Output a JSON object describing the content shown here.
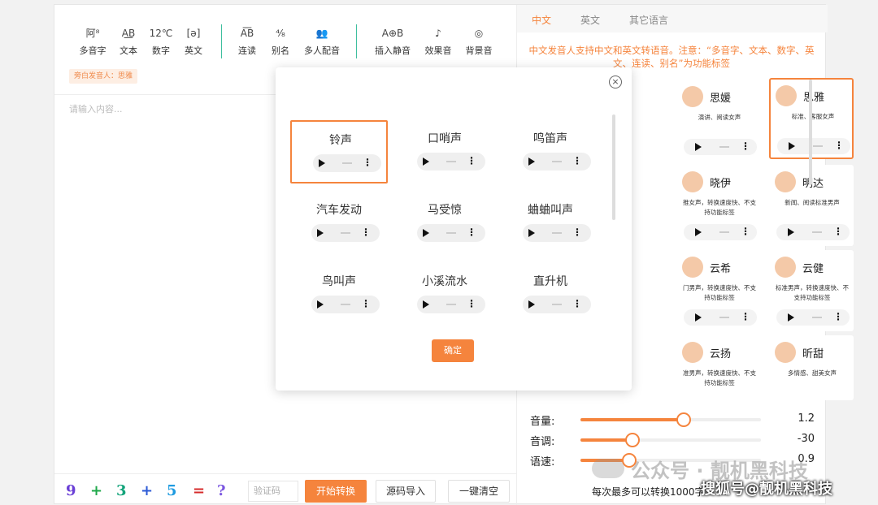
{
  "toolbar": {
    "items": [
      {
        "icon_text": "阿⁸",
        "label": "多音字"
      },
      {
        "icon_text": "A͟B",
        "label": "文本"
      },
      {
        "icon_text": "12℃",
        "label": "数字"
      },
      {
        "icon_text": "[ə]",
        "label": "英文"
      },
      {
        "icon_text": "A͞B",
        "label": "连读"
      },
      {
        "icon_text": "⁴⁄₈",
        "label": "别名"
      },
      {
        "icon_text": "👥",
        "label": "多人配音"
      },
      {
        "icon_text": "A⊕B",
        "label": "插入静音"
      },
      {
        "icon_text": "♪",
        "label": "效果音"
      },
      {
        "icon_text": "◎",
        "label": "背景音"
      }
    ]
  },
  "narrator_tag": "旁白发音人：思雅",
  "editor": {
    "placeholder": "请输入内容..."
  },
  "bottom": {
    "captcha_chars": [
      "9",
      "+",
      "3",
      "+",
      "5",
      "=",
      "?"
    ],
    "captcha_colors": [
      "#6a3fd6",
      "#1fa84a",
      "#12a37a",
      "#2d5bd6",
      "#1f9be0",
      "#d62b2b",
      "#7a55e0"
    ],
    "captcha_placeholder": "验证码",
    "start_label": "开始转换",
    "import_label": "源码导入",
    "clear_label": "一键清空"
  },
  "right": {
    "tabs": [
      "中文",
      "英文",
      "其它语言"
    ],
    "notice": "中文发音人支持中文和英文转语音。注意：“多音字、文本、数字、英文、连读、别名”为功能标签",
    "voices": [
      {
        "name": "思媛",
        "desc": "演讲、阅读女声"
      },
      {
        "name": "思雅",
        "desc": "标准、客服女声"
      },
      {
        "name": "晓伊",
        "desc": "推女声，转换速度快、不支持功能标签"
      },
      {
        "name": "明达",
        "desc": "新闻、阅读标准男声"
      },
      {
        "name": "云希",
        "desc": "门男声，转换速度快、不支持功能标签"
      },
      {
        "name": "云健",
        "desc": "标准男声，转换速度快、不支持功能标签"
      },
      {
        "name": "云扬",
        "desc": "准男声，转换速度快、不支持功能标签"
      },
      {
        "name": "昕甜",
        "desc": "多情感、甜美女声"
      }
    ],
    "sliders": [
      {
        "label": "音量:",
        "value": "1.2",
        "fraction": 0.57
      },
      {
        "label": "音调:",
        "value": "-30",
        "fraction": 0.29
      },
      {
        "label": "语速:",
        "value": "0.9",
        "fraction": 0.27
      }
    ],
    "limit_text": "每次最多可以转换1000字"
  },
  "modal": {
    "sounds": [
      "铃声",
      "口哨声",
      "鸣笛声",
      "汽车发动",
      "马受惊",
      "蛐蛐叫声",
      "鸟叫声",
      "小溪流水",
      "直升机"
    ],
    "confirm_label": "确定"
  },
  "watermark": {
    "text1": "公众号 · 靓机黑科技",
    "text2": "搜狐号@靓机黑科技"
  },
  "colors": {
    "accent": "#f5843d",
    "teal_separator": "#3fbf9f"
  }
}
